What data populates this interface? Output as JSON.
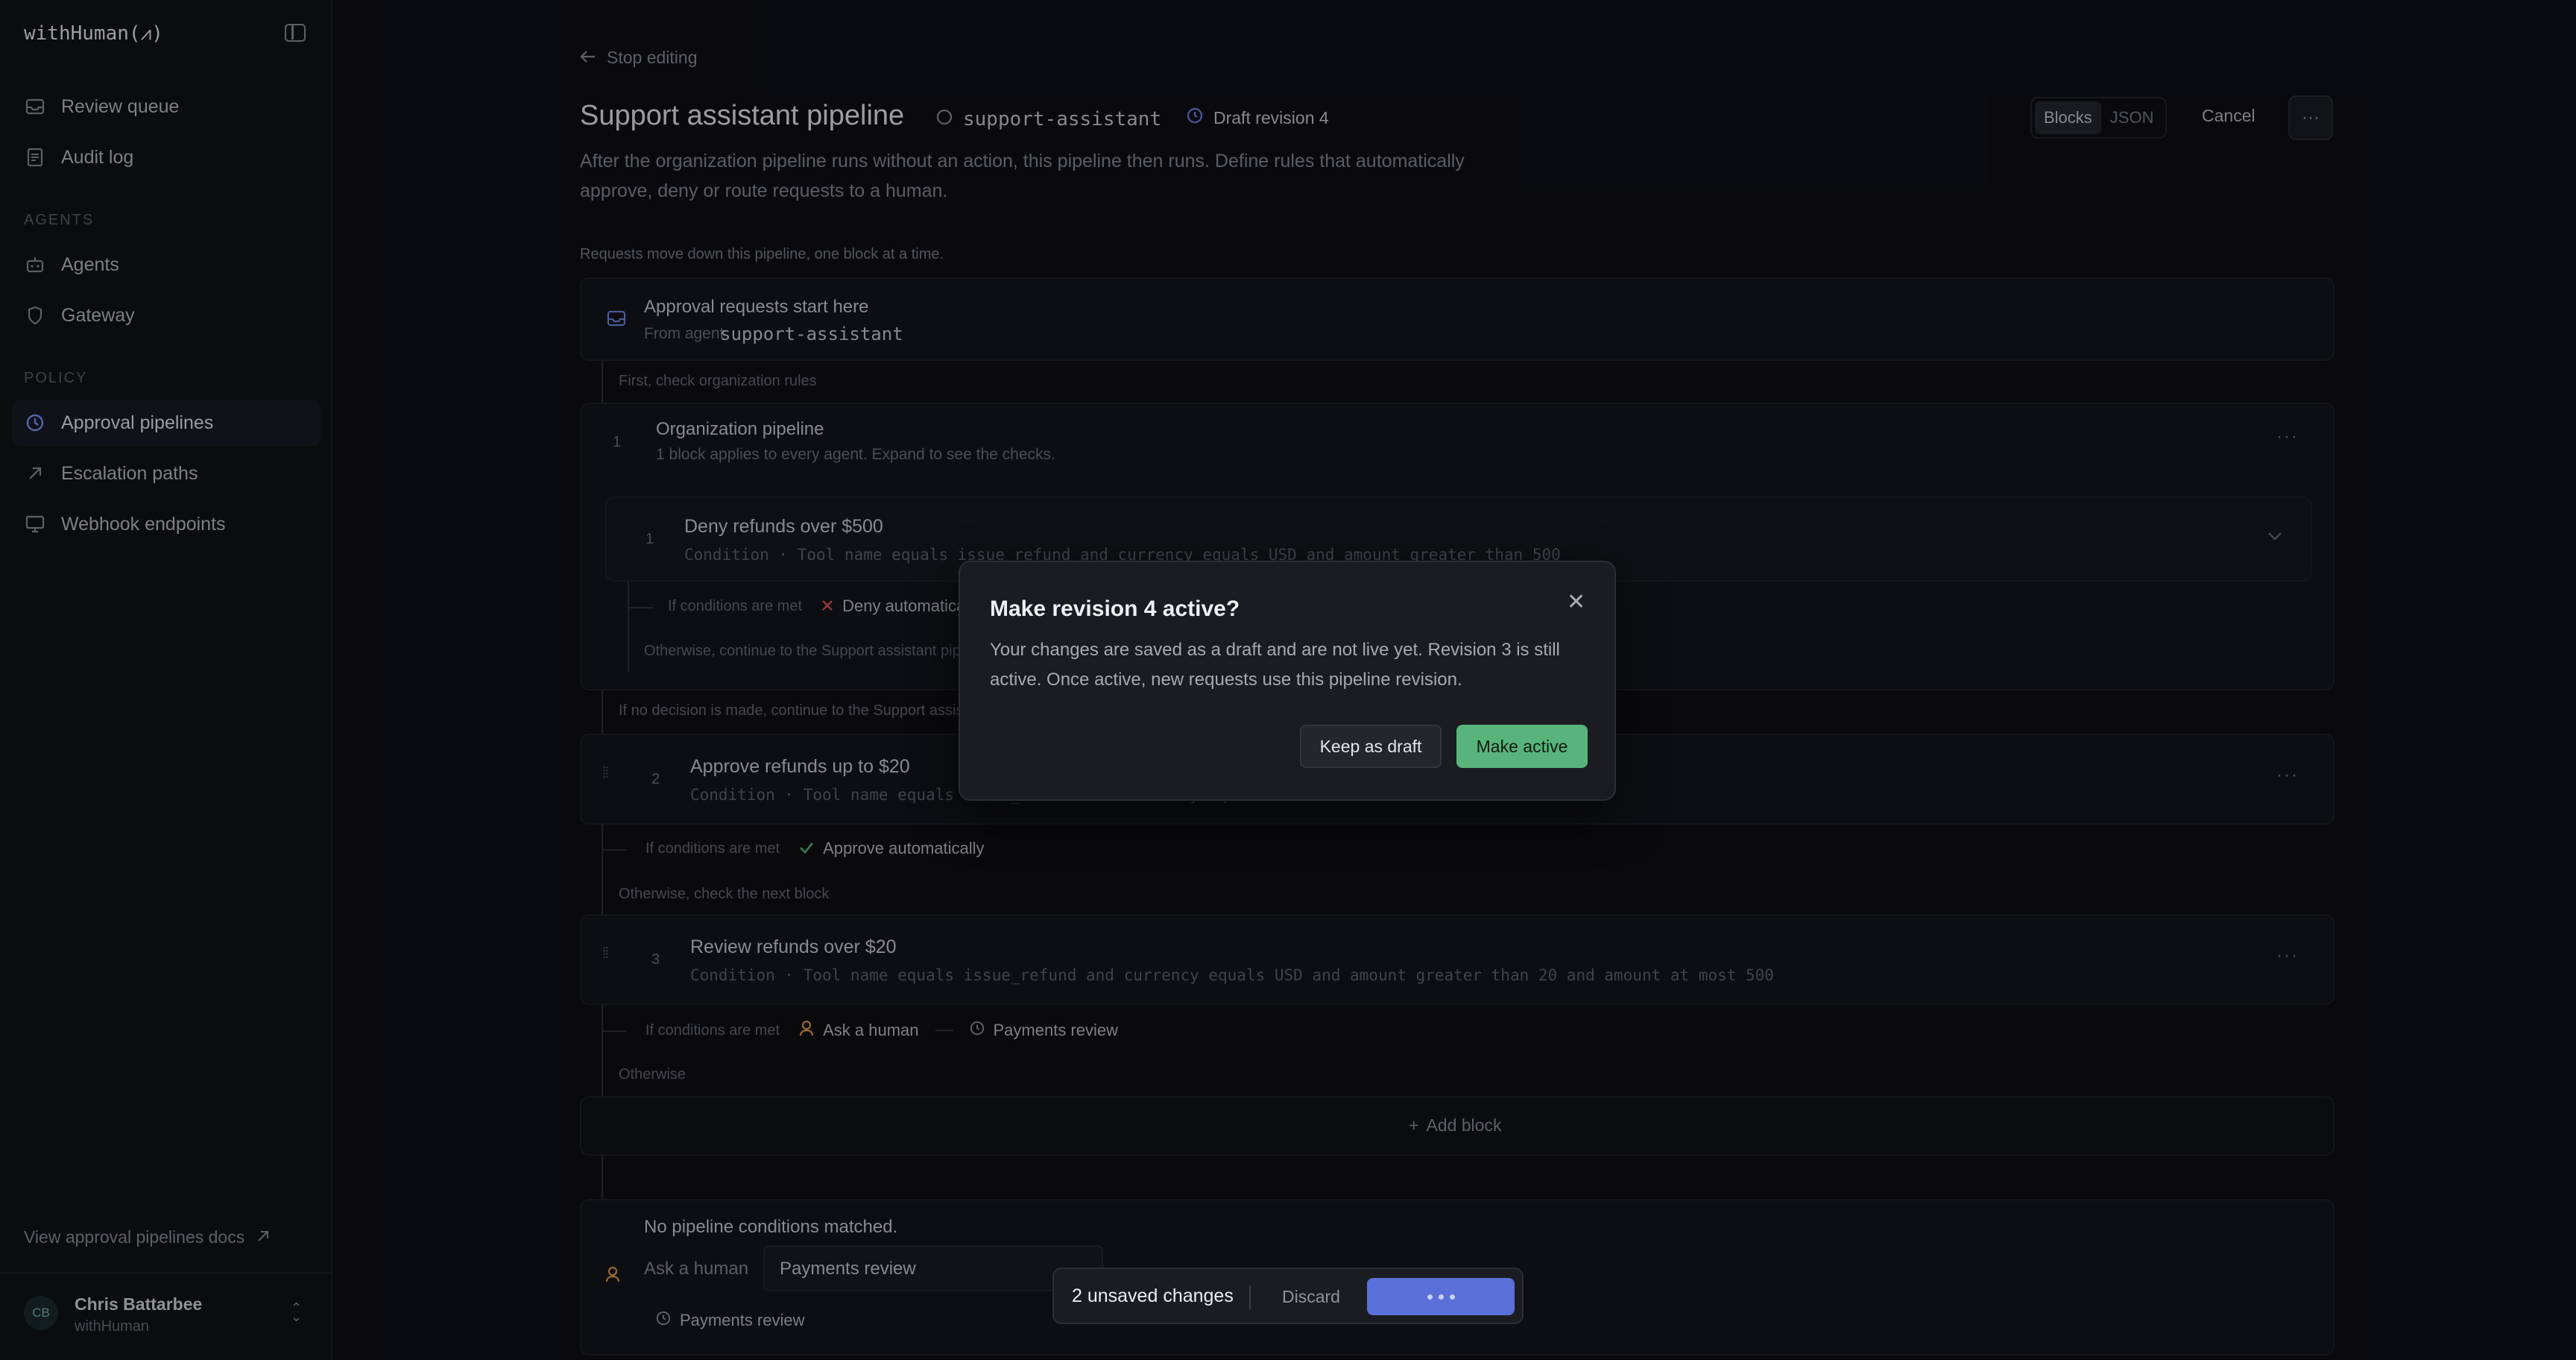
{
  "app": {
    "brand": "withHuman(⩘)"
  },
  "sidebar": {
    "items_top": [
      {
        "label": "Review queue",
        "icon": "inbox-icon"
      },
      {
        "label": "Audit log",
        "icon": "document-icon"
      }
    ],
    "sections": [
      {
        "title": "AGENTS",
        "items": [
          {
            "label": "Agents",
            "icon": "robot-icon"
          },
          {
            "label": "Gateway",
            "icon": "shield-icon"
          }
        ]
      },
      {
        "title": "POLICY",
        "items": [
          {
            "label": "Approval pipelines",
            "icon": "pipeline-icon",
            "active": true
          },
          {
            "label": "Escalation paths",
            "icon": "arrow-up-right-icon"
          },
          {
            "label": "Webhook endpoints",
            "icon": "monitor-icon"
          }
        ]
      }
    ],
    "docs_link": "View approval pipelines docs",
    "user": {
      "initials": "CB",
      "name": "Chris Battarbee",
      "org": "withHuman"
    }
  },
  "header": {
    "back": "Stop editing",
    "title": "Support assistant pipeline",
    "agent": "support-assistant",
    "revision": "Draft revision 4",
    "view_modes": [
      "Blocks",
      "JSON"
    ],
    "active_view": "Blocks",
    "cancel": "Cancel",
    "description": "After the organization pipeline runs without an action, this pipeline then runs. Define rules that automatically approve, deny or route requests to a human."
  },
  "pipeline": {
    "hint": "Requests move down this pipeline, one block at a time.",
    "start": {
      "title": "Approval requests start here",
      "from_prefix": "From agent",
      "agent": "support-assistant"
    },
    "org_label": "First, check organization rules",
    "org": {
      "number": "1",
      "title": "Organization pipeline",
      "subtitle": "1 block applies to every agent. Expand to see the checks.",
      "block": {
        "number": "1",
        "title": "Deny refunds over $500",
        "condition": "Condition · Tool name equals issue_refund and currency equals USD and amount greater than 500"
      },
      "if_met": "If conditions are met",
      "outcome": "Deny automatically",
      "otherwise": "Otherwise, continue to the Support assistant pipeline"
    },
    "after_org_label": "If no decision is made, continue to the Support assistant pipeline",
    "blocks": [
      {
        "number": "2",
        "title": "Approve refunds up to $20",
        "condition": "Condition · Tool name equals issue_refund and currency equals USD and amount at most 20",
        "if_met": "If conditions are met",
        "outcome": "Approve automatically",
        "next": "Otherwise, check the next block"
      },
      {
        "number": "3",
        "title": "Review refunds over $20",
        "condition": "Condition · Tool name equals issue_refund and currency equals USD and amount greater than 20 and amount at most 500",
        "if_met": "If conditions are met",
        "outcome": "Ask a human",
        "route": "Payments review",
        "next": "Otherwise"
      }
    ],
    "add_block": "Add block",
    "fallback": {
      "title": "No pipeline conditions matched.",
      "action": "Ask a human",
      "select_value": "Payments review",
      "route": "Payments review"
    }
  },
  "modal": {
    "title": "Make revision 4 active?",
    "body": "Your changes are saved as a draft and are not live yet. Revision 3 is still active. Once active, new requests use this pipeline revision.",
    "secondary": "Keep as draft",
    "primary": "Make active"
  },
  "savebar": {
    "count": "2 unsaved changes",
    "discard": "Discard"
  },
  "colors": {
    "accent": "#5b6fd8",
    "success": "#58b47a",
    "danger": "#e05252",
    "human": "#e09a4a"
  }
}
